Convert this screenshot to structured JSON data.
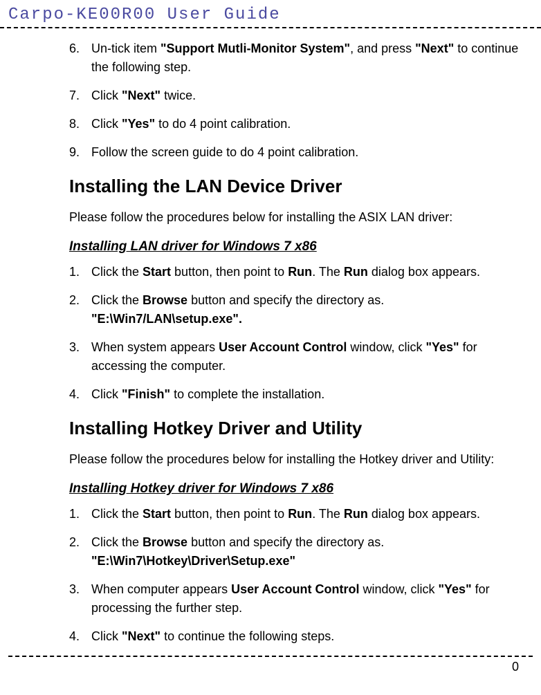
{
  "header": {
    "title": "Carpo-KE00R00 User Guide"
  },
  "topList": [
    {
      "num": "6.",
      "parts": [
        "Un-tick item ",
        {
          "b": "\"Support Mutli-Monitor System\""
        },
        ", and press ",
        {
          "b": "\"Next\""
        },
        " to continue the following step."
      ]
    },
    {
      "num": "7.",
      "parts": [
        "Click ",
        {
          "b": "\"Next\""
        },
        " twice."
      ]
    },
    {
      "num": "8.",
      "parts": [
        "Click ",
        {
          "b": "\"Yes\""
        },
        " to do 4 point calibration."
      ]
    },
    {
      "num": "9.",
      "parts": [
        "Follow the screen guide to do 4 point calibration."
      ]
    }
  ],
  "section1": {
    "title": "Installing the LAN Device Driver",
    "intro": "Please follow the procedures below for installing the ASIX LAN driver:",
    "subtitle": "Installing LAN driver for Windows 7 x86",
    "list": [
      {
        "num": "1.",
        "parts": [
          "Click the ",
          {
            "b": "Start"
          },
          " button, then point to ",
          {
            "b": "Run"
          },
          ". The ",
          {
            "b": "Run"
          },
          " dialog box appears."
        ]
      },
      {
        "num": "2.",
        "parts": [
          "Click the ",
          {
            "b": "Browse"
          },
          " button and specify the directory as. ",
          {
            "b": "\"E:\\Win7/LAN\\setup.exe\"."
          }
        ]
      },
      {
        "num": "3.",
        "parts": [
          "When system appears ",
          {
            "b": "User Account Control"
          },
          " window, click ",
          {
            "b": "\"Yes\""
          },
          " for accessing the computer."
        ]
      },
      {
        "num": "4.",
        "parts": [
          "Click ",
          {
            "b": "\"Finish\""
          },
          " to complete the installation."
        ]
      }
    ]
  },
  "section2": {
    "title": "Installing Hotkey Driver and Utility",
    "intro": "Please follow the procedures below for installing the Hotkey driver and Utility:",
    "subtitle": "Installing Hotkey driver for Windows 7 x86",
    "list": [
      {
        "num": "1.",
        "parts": [
          "Click the ",
          {
            "b": "Start"
          },
          " button, then point to ",
          {
            "b": "Run"
          },
          ". The ",
          {
            "b": "Run"
          },
          " dialog box appears."
        ]
      },
      {
        "num": "2.",
        "parts": [
          "Click the ",
          {
            "b": "Browse"
          },
          " button and specify the directory as. ",
          {
            "b": "\"E:\\Win7\\Hotkey\\Driver\\Setup.exe\""
          }
        ]
      },
      {
        "num": "3.",
        "parts": [
          "When computer appears ",
          {
            "b": "User Account Control"
          },
          " window, click ",
          {
            "b": "\"Yes\""
          },
          " for processing the further step."
        ]
      },
      {
        "num": "4.",
        "parts": [
          "Click ",
          {
            "b": "\"Next\""
          },
          " to continue the following steps."
        ]
      }
    ]
  },
  "footer": {
    "pageNumber": "0"
  }
}
